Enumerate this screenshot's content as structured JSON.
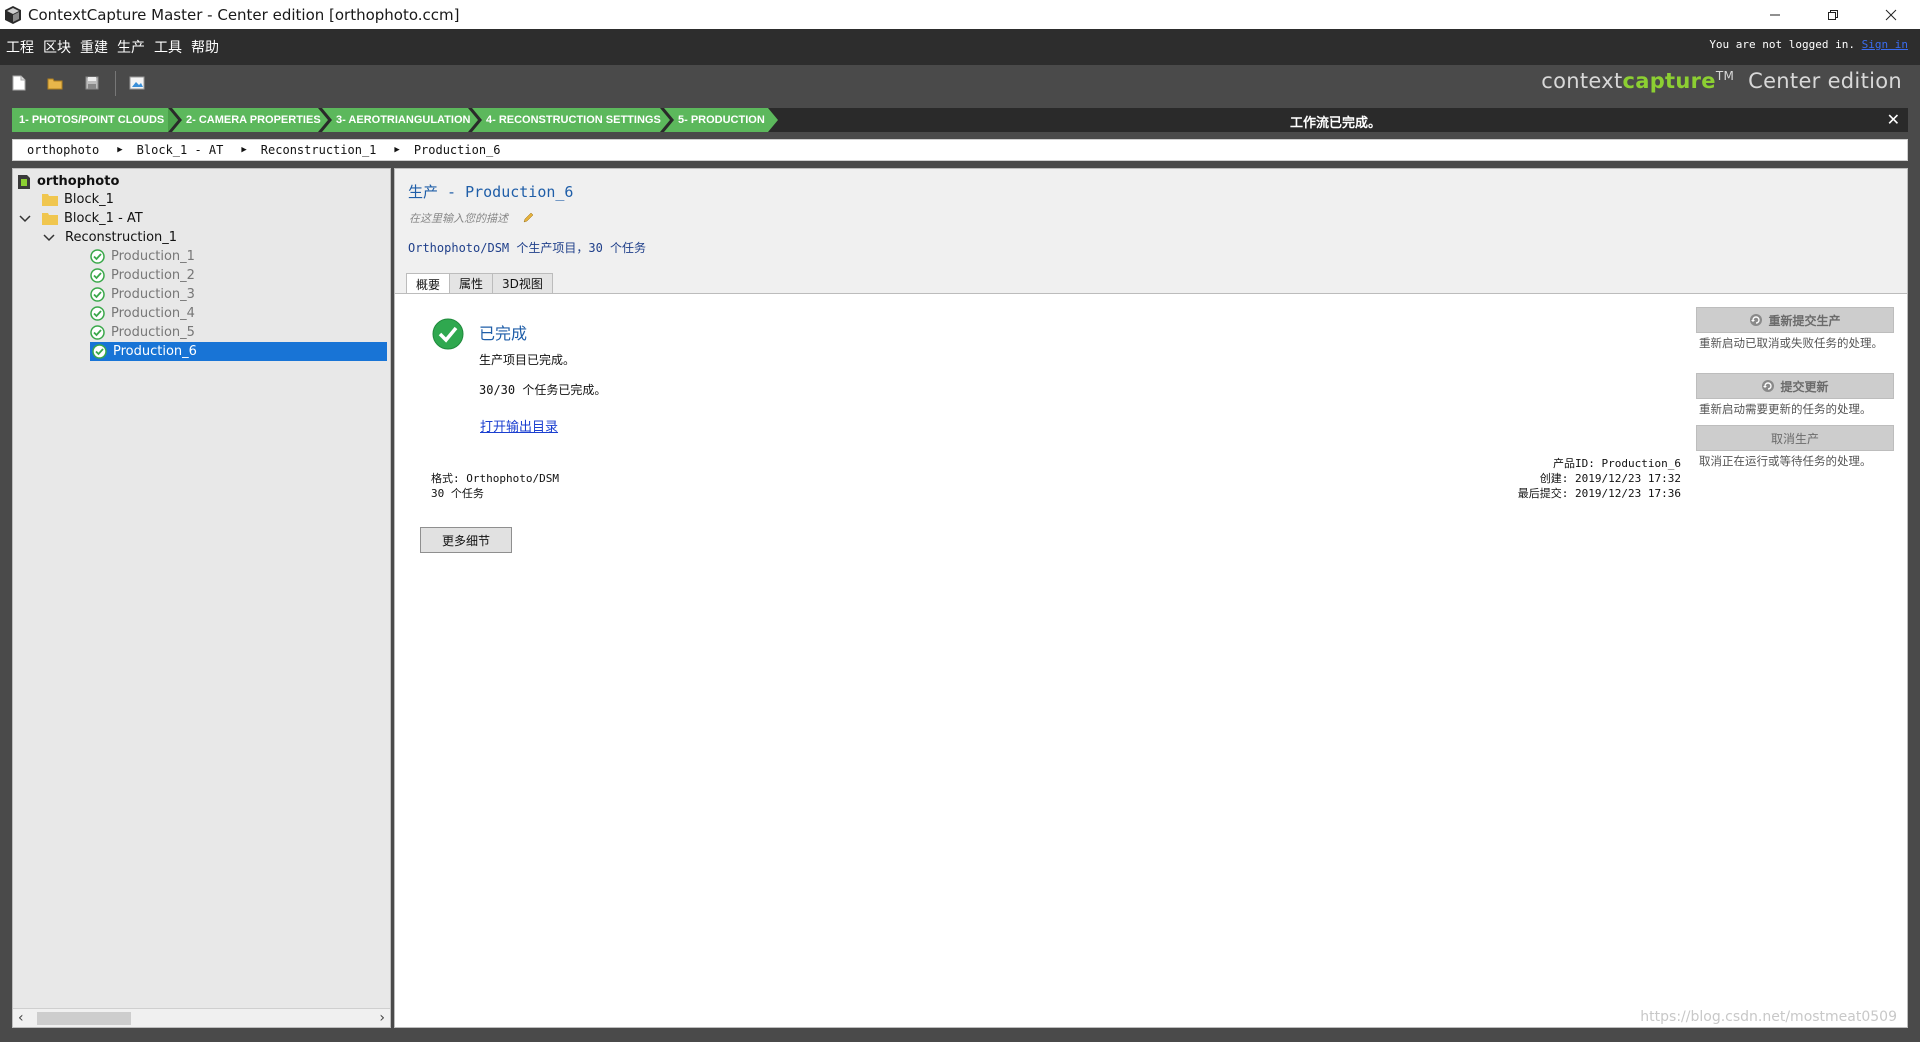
{
  "window": {
    "title": "ContextCapture Master - Center edition [orthophoto.ccm]"
  },
  "menu": {
    "items": [
      "工程",
      "区块",
      "重建",
      "生产",
      "工具",
      "帮助"
    ],
    "login_text": "You are not logged in.",
    "sign_in": "Sign in"
  },
  "brand": {
    "context": "context",
    "capture": "capture",
    "tm": "TM",
    "edition": "Center edition"
  },
  "workflow": {
    "steps": [
      "1- PHOTOS/POINT CLOUDS",
      "2- CAMERA PROPERTIES",
      "3- AEROTRIANGULATION",
      "4- RECONSTRUCTION SETTINGS",
      "5- PRODUCTION"
    ],
    "status": "工作流已完成。",
    "step_color": "#5cb85c"
  },
  "breadcrumb": [
    "orthophoto",
    "Block_1 - AT",
    "Reconstruction_1",
    "Production_6"
  ],
  "tree": {
    "root": "orthophoto",
    "block1": "Block_1",
    "block1at": "Block_1 - AT",
    "reconstruction": "Reconstruction_1",
    "productions": [
      "Production_1",
      "Production_2",
      "Production_3",
      "Production_4",
      "Production_5",
      "Production_6"
    ]
  },
  "main": {
    "title": "生产 - Production_6",
    "description_placeholder": "在这里输入您的描述",
    "summary": "Orthophoto/DSM 个生产项目，30 个任务",
    "tabs": [
      "概要",
      "属性",
      "3D视图"
    ],
    "status_title": "已完成",
    "status_line1": "生产项目已完成。",
    "status_line2": "30/30 个任务已完成。",
    "open_output": "打开输出目录",
    "format_line": "格式: Orthophoto/DSM",
    "tasks_line": "30 个任务",
    "product_id": "产品ID: Production_6",
    "created": "创建: 2019/12/23 17:32",
    "last_submitted": "最后提交: 2019/12/23 17:36",
    "more_details": "更多细节"
  },
  "actions": {
    "resubmit_label": "重新提交生产",
    "resubmit_note": "重新启动已取消或失败任务的处理。",
    "update_label": "提交更新",
    "update_note": "重新启动需要更新的任务的处理。",
    "cancel_label": "取消生产",
    "cancel_note": "取消正在运行或等待任务的处理。"
  },
  "watermark": "https://blog.csdn.net/mostmeat0509"
}
